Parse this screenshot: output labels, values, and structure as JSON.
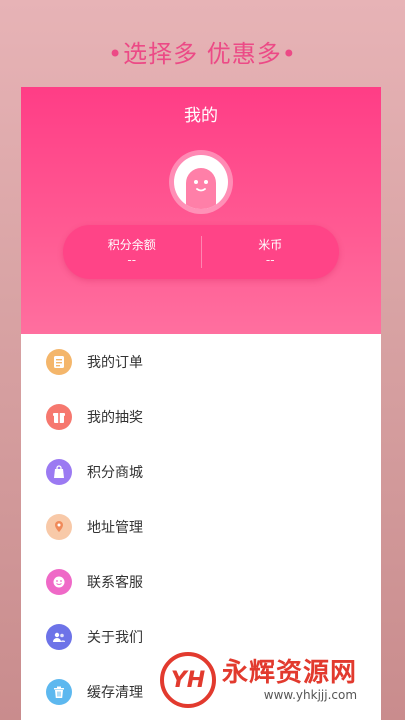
{
  "promo": {
    "text": "•选择多 优惠多•"
  },
  "header": {
    "title": "我的"
  },
  "stats": [
    {
      "label": "积分余额",
      "value": "--"
    },
    {
      "label": "米币",
      "value": "--"
    }
  ],
  "menu": [
    {
      "label": "我的订单",
      "icon": "orders-icon",
      "color": "#f4b66b"
    },
    {
      "label": "我的抽奖",
      "icon": "lottery-icon",
      "color": "#f6786f"
    },
    {
      "label": "积分商城",
      "icon": "points-mall-icon",
      "color": "#9b7af2"
    },
    {
      "label": "地址管理",
      "icon": "address-icon",
      "color": "#f8c9a8"
    },
    {
      "label": "联系客服",
      "icon": "customer-service-icon",
      "color": "#ef69c7"
    },
    {
      "label": "关于我们",
      "icon": "about-icon",
      "color": "#6d73e8"
    },
    {
      "label": "缓存清理",
      "icon": "cache-clear-icon",
      "color": "#5db8ef"
    }
  ],
  "watermark": {
    "logo": "YH",
    "title": "永辉资源网",
    "url": "www.yhkjjj.com"
  }
}
